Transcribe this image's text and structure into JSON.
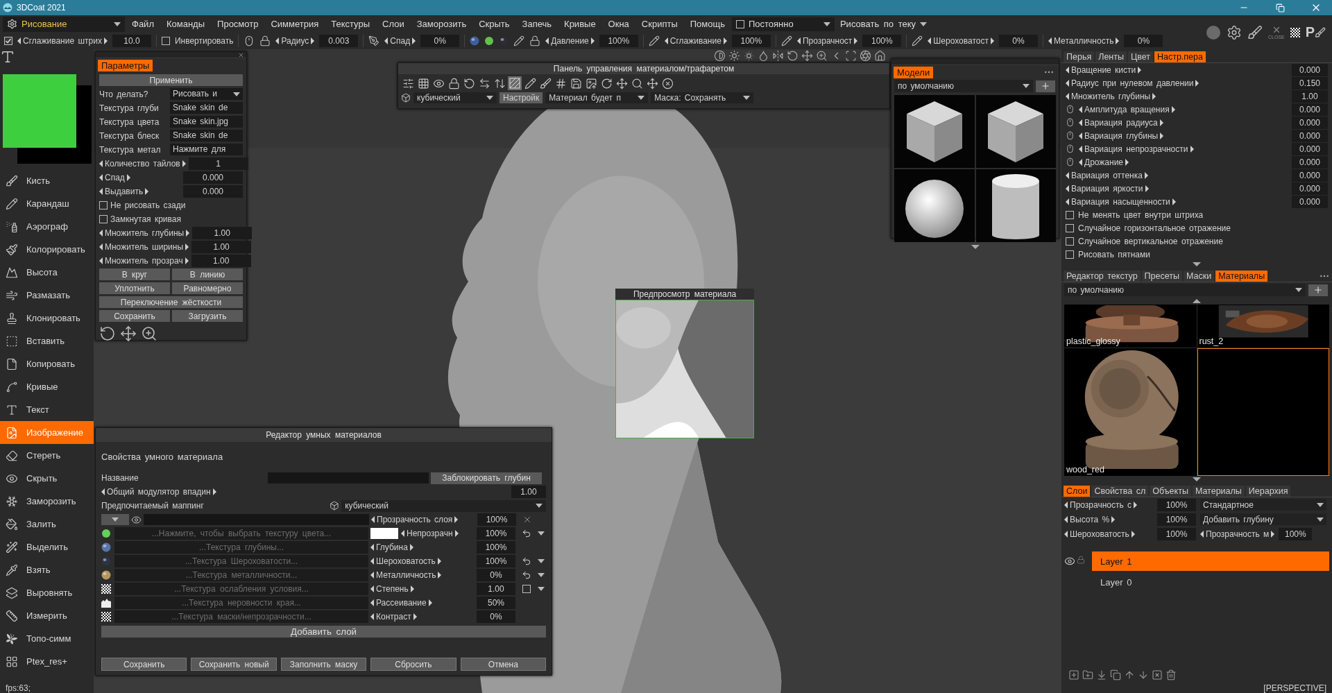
{
  "window": {
    "title": "3DCoat 2021"
  },
  "menubar": {
    "room": "Рисование",
    "items": [
      "Файл",
      "Команды",
      "Просмотр",
      "Симметрия",
      "Текстуры",
      "Слои",
      "Заморозить",
      "Скрыть",
      "Запечь",
      "Кривые",
      "Окна",
      "Скрипты",
      "Помощь"
    ],
    "constant": {
      "label": "Постоянно",
      "checked": false
    },
    "paint_mode": "Рисовать по теку"
  },
  "toolbar": [
    {
      "kind": "check_param",
      "label": "Сглаживание штрих",
      "value": "10.0",
      "checked": true
    },
    {
      "kind": "check",
      "label": "Инвертировать",
      "checked": false
    },
    {
      "kind": "param",
      "label": "Радиус",
      "value": "0.003"
    },
    {
      "kind": "param",
      "label": "Спад",
      "value": "0%"
    },
    {
      "kind": "param",
      "label": "Давление",
      "value": "100%"
    },
    {
      "kind": "param",
      "label": "Сглаживание",
      "value": "100%"
    },
    {
      "kind": "param",
      "label": "Прозрачност",
      "value": "100%"
    },
    {
      "kind": "param",
      "label": "Шероховатост",
      "value": "0%"
    },
    {
      "kind": "param",
      "label": "Металличность",
      "value": "0%"
    }
  ],
  "corner_tools": {
    "close_label": "CLOSE",
    "pen_letter": "P"
  },
  "tools": [
    {
      "label": "Кисть",
      "selected": false
    },
    {
      "label": "Карандаш",
      "selected": false
    },
    {
      "label": "Аэрограф",
      "selected": false
    },
    {
      "label": "Колорировать",
      "selected": false
    },
    {
      "label": "Высота",
      "selected": false
    },
    {
      "label": "Размазать",
      "selected": false
    },
    {
      "label": "Клонировать",
      "selected": false
    },
    {
      "label": "Вставить",
      "selected": false
    },
    {
      "label": "Копировать",
      "selected": false
    },
    {
      "label": "Кривые",
      "selected": false
    },
    {
      "label": "Текст",
      "selected": false
    },
    {
      "label": "Изображение",
      "selected": true
    },
    {
      "label": "Стереть",
      "selected": false
    },
    {
      "label": "Скрыть",
      "selected": false
    },
    {
      "label": "Заморозить",
      "selected": false
    },
    {
      "label": "Залить",
      "selected": false
    },
    {
      "label": "Выделить",
      "selected": false
    },
    {
      "label": "Взять",
      "selected": false
    },
    {
      "label": "Выровнять",
      "selected": false
    },
    {
      "label": "Измерить",
      "selected": false
    },
    {
      "label": "Топо-симм",
      "selected": false
    },
    {
      "label": "Ptex_res+",
      "selected": false
    }
  ],
  "fps": "fps:63;",
  "params_panel": {
    "title": "Параметры",
    "apply": "Применить",
    "rows": [
      {
        "kind": "select",
        "label": "Что делать?",
        "value": "Рисовать и"
      },
      {
        "kind": "texture",
        "label": "Текстура глуби",
        "value": "Snake skin de"
      },
      {
        "kind": "texture",
        "label": "Текстура цвета",
        "value": "Snake skin.jpg"
      },
      {
        "kind": "texture",
        "label": "Текстура блеск",
        "value": "Snake skin de"
      },
      {
        "kind": "texture",
        "label": "Текстура метал",
        "value": "Нажмите для"
      },
      {
        "kind": "number",
        "label": "Количество тайлов",
        "value": "1"
      },
      {
        "kind": "number",
        "label": "Спад",
        "value": "0.000"
      },
      {
        "kind": "number",
        "label": "Выдавить",
        "value": "0.000"
      },
      {
        "kind": "check",
        "label": "Не рисовать сзади",
        "checked": false
      },
      {
        "kind": "check",
        "label": "Замкнутая кривая",
        "checked": false
      },
      {
        "kind": "number",
        "label": "Множитель глубины",
        "value": "1.00"
      },
      {
        "kind": "number",
        "label": "Множитель ширины",
        "value": "1.00"
      },
      {
        "kind": "number",
        "label": "Множитель прозрач",
        "value": "1.00"
      }
    ],
    "button_rows": [
      [
        "В круг",
        "В линию"
      ],
      [
        "Уплотнить",
        "Равномерно"
      ],
      [
        "Переключение жёсткости"
      ],
      [
        "Сохранить",
        "Загрузить"
      ]
    ]
  },
  "material_panel": {
    "title": "Панель управления материалом/трафаретом",
    "icons": [
      {
        "selected": false
      },
      {
        "selected": false
      },
      {
        "selected": false
      },
      {
        "selected": false
      },
      {
        "selected": false
      },
      {
        "selected": false
      },
      {
        "selected": false
      },
      {
        "selected": true
      },
      {
        "selected": false
      },
      {
        "selected": false
      },
      {
        "selected": false
      },
      {
        "selected": false
      },
      {
        "selected": false
      },
      {
        "selected": false
      },
      {
        "selected": false
      },
      {
        "selected": false
      },
      {
        "selected": false
      },
      {
        "selected": false
      }
    ],
    "mapping": "кубический",
    "settings": {
      "label": "Настройк",
      "selected": true
    },
    "material_mode": "Материал будет п",
    "mask": "Маска: Сохранять"
  },
  "models_panel": {
    "title": "Модели",
    "preset": "по умолчанию",
    "items": [
      {
        "kind": "cube"
      },
      {
        "kind": "cube"
      },
      {
        "kind": "sphere"
      },
      {
        "kind": "cylinder"
      }
    ]
  },
  "preview": {
    "title": "Предпросмотр материала"
  },
  "smart_editor": {
    "title": "Редактор умных материалов",
    "heading": "Свойства умного материала",
    "name_label": "Название",
    "lock_button": "Заблокировать глубин",
    "modulator": {
      "label": "Общий модулятор впадин",
      "value": "1.00"
    },
    "mapping": {
      "label": "Предпочитаемый маппинг",
      "value": "кубический"
    },
    "layer_opacity": {
      "label": "Прозрачность слоя",
      "value": "100%"
    },
    "channels": [
      {
        "kind": "color",
        "texture": "...Нажмите, чтобы выбрать текстуру цвета...",
        "param": "Непрозрачн",
        "value": "100%",
        "color": "#ffffff",
        "reset_button": true
      },
      {
        "kind": "depth",
        "texture": "...Текстура глубины...",
        "param": "Глубина",
        "value": "100%",
        "reset_button": false
      },
      {
        "kind": "roughness",
        "texture": "...Текстура Шероховатости...",
        "param": "Шероховатость",
        "value": "100%",
        "reset_button": true
      },
      {
        "kind": "metalness",
        "texture": "...Текстура металличности...",
        "param": "Металличность",
        "value": "0%",
        "reset_button": true
      },
      {
        "kind": "condition",
        "texture": "...Текстура ослабления условия...",
        "param": "Степень",
        "value": "1.00",
        "reset_button": false,
        "checked": false
      },
      {
        "kind": "edge",
        "texture": "...Текстура неровности края...",
        "param": "Рассеивание",
        "value": "50%",
        "reset_button": false
      },
      {
        "kind": "mask",
        "texture": "...Текстура маски/непрозрачности...",
        "param": "Контраст",
        "value": "0%",
        "reset_button": false
      }
    ],
    "add_layer": "Добавить слой",
    "buttons": [
      "Сохранить",
      "Сохранить новый",
      "Заполнить маску",
      "Сбросить",
      "Отмена"
    ]
  },
  "brush_tabs": [
    {
      "label": "Перья",
      "selected": false
    },
    {
      "label": "Ленты",
      "selected": false
    },
    {
      "label": "Цвет",
      "selected": false
    },
    {
      "label": "Настр.пера",
      "selected": true
    }
  ],
  "brush_settings": [
    {
      "kind": "number",
      "label": "Вращение кисти",
      "value": "0.000"
    },
    {
      "kind": "number",
      "label": "Радиус при нулевом давлении",
      "value": "0.150"
    },
    {
      "kind": "number",
      "label": "Множитель глубины",
      "value": "1.00"
    },
    {
      "kind": "mouse_number",
      "label": "Амплитуда вращения",
      "value": "0.000"
    },
    {
      "kind": "mouse_number",
      "label": "Вариация радиуса",
      "value": "0.000"
    },
    {
      "kind": "mouse_number",
      "label": "Вариация глубины",
      "value": "0.000"
    },
    {
      "kind": "mouse_number",
      "label": "Вариация непрозрачности",
      "value": "0.000"
    },
    {
      "kind": "mouse_number",
      "label": "Дрожание",
      "value": "0.000"
    },
    {
      "kind": "number",
      "label": "Вариация оттенка",
      "value": "0.000"
    },
    {
      "kind": "number",
      "label": "Вариация яркости",
      "value": "0.000"
    },
    {
      "kind": "number",
      "label": "Вариация насыщенности",
      "value": "0.000"
    },
    {
      "kind": "check",
      "label": "Не менять цвет внутри штриха",
      "checked": false
    },
    {
      "kind": "check",
      "label": "Случайное горизонтальное отражение",
      "checked": false
    },
    {
      "kind": "check",
      "label": "Случайное вертикальное отражение",
      "checked": false
    },
    {
      "kind": "check",
      "label": "Рисовать пятнами",
      "checked": false
    }
  ],
  "material_tabs": [
    {
      "label": "Редактор текстур",
      "selected": false
    },
    {
      "label": "Пресеты",
      "selected": false
    },
    {
      "label": "Маски",
      "selected": false
    },
    {
      "label": "Материалы",
      "selected": true
    }
  ],
  "materials": {
    "preset": "по умолчанию",
    "items": [
      {
        "label": "plastic_glossy",
        "selected": false
      },
      {
        "label": "rust_2",
        "selected": false
      },
      {
        "label": "wood_red",
        "selected": false
      },
      {
        "selected": true
      }
    ]
  },
  "layer_tabs": [
    {
      "label": "Слои",
      "selected": true
    },
    {
      "label": "Свойства сл",
      "selected": false
    },
    {
      "label": "Объекты",
      "selected": false
    },
    {
      "label": "Материалы",
      "selected": false
    },
    {
      "label": "Иерархия",
      "selected": false
    }
  ],
  "layer_props": {
    "rows": [
      {
        "label": "Прозрачность с",
        "value": "100%"
      },
      {
        "label": "Высота %",
        "value": "100%"
      },
      {
        "label": "Шероховатость",
        "value": "100%"
      }
    ],
    "blend": "Стандартное",
    "depth_mode": "Добавить глубину",
    "mask_opacity": {
      "label": "Прозрачность м",
      "value": "100%"
    }
  },
  "layers": [
    {
      "name": "Layer 1",
      "selected": true
    },
    {
      "name": "Layer 0",
      "selected": false
    }
  ],
  "view_mode": "[PERSPECTIVE]"
}
